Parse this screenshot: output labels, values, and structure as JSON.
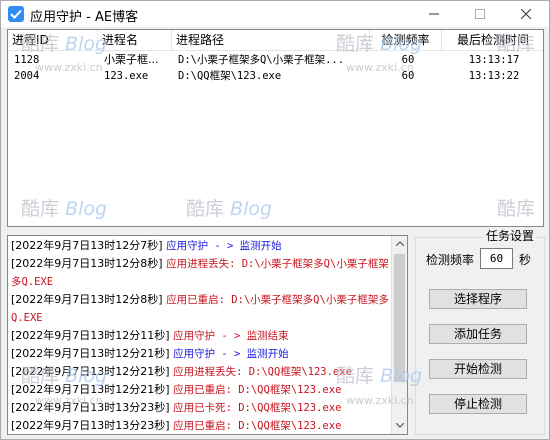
{
  "window": {
    "title": "应用守护 - AE博客"
  },
  "process_list": {
    "columns": [
      "进程ID",
      "进程名",
      "进程路径",
      "检测频率",
      "最后检测时间"
    ],
    "rows": [
      {
        "pid": "1128",
        "name": "小栗子框...",
        "path": "D:\\小栗子框架多Q\\小栗子框架...",
        "freq": "60",
        "last_check": "13:13:17"
      },
      {
        "pid": "2004",
        "name": "123.exe",
        "path": "D:\\QQ框架\\123.exe",
        "freq": "60",
        "last_check": "13:13:22"
      }
    ]
  },
  "log": {
    "lines": [
      {
        "ts": "[2022年9月7日13时12分7秒]",
        "msg": "应用守护 - > 监测开始",
        "color": "blue"
      },
      {
        "ts": "[2022年9月7日13时12分8秒]",
        "msg": "应用进程丢失: D:\\小栗子框架多Q\\小栗子框架多Q.EXE",
        "color": "red"
      },
      {
        "ts": "[2022年9月7日13时12分8秒]",
        "msg": "应用已重启: D:\\小栗子框架多Q\\小栗子框架多Q.EXE",
        "color": "red"
      },
      {
        "ts": "[2022年9月7日13时12分11秒]",
        "msg": "应用守护 - > 监测结束",
        "color": "red"
      },
      {
        "ts": "[2022年9月7日13时12分21秒]",
        "msg": "应用守护 - > 监测开始",
        "color": "blue"
      },
      {
        "ts": "[2022年9月7日13时12分21秒]",
        "msg": "应用进程丢失: D:\\QQ框架\\123.exe",
        "color": "red"
      },
      {
        "ts": "[2022年9月7日13时12分21秒]",
        "msg": "应用已重启: D:\\QQ框架\\123.exe",
        "color": "red"
      },
      {
        "ts": "[2022年9月7日13时13分23秒]",
        "msg": "应用已卡死: D:\\QQ框架\\123.exe",
        "color": "red"
      },
      {
        "ts": "[2022年9月7日13时13分23秒]",
        "msg": "应用已重启: D:\\QQ框架\\123.exe",
        "color": "red"
      }
    ]
  },
  "settings": {
    "group_title": "任务设置",
    "freq_label": "检测频率",
    "freq_value": "60",
    "freq_unit": "秒",
    "buttons": {
      "select_program": "选择程序",
      "add_task": "添加任务",
      "start_check": "开始检测",
      "stop_check": "停止检测"
    }
  },
  "watermark": {
    "brand": "酷库",
    "blog": "Blog",
    "url": "www.zxki.cn"
  },
  "colors": {
    "accent": "#2f8df4",
    "log_blue": "#1a1adb",
    "log_red": "#c8141e"
  }
}
